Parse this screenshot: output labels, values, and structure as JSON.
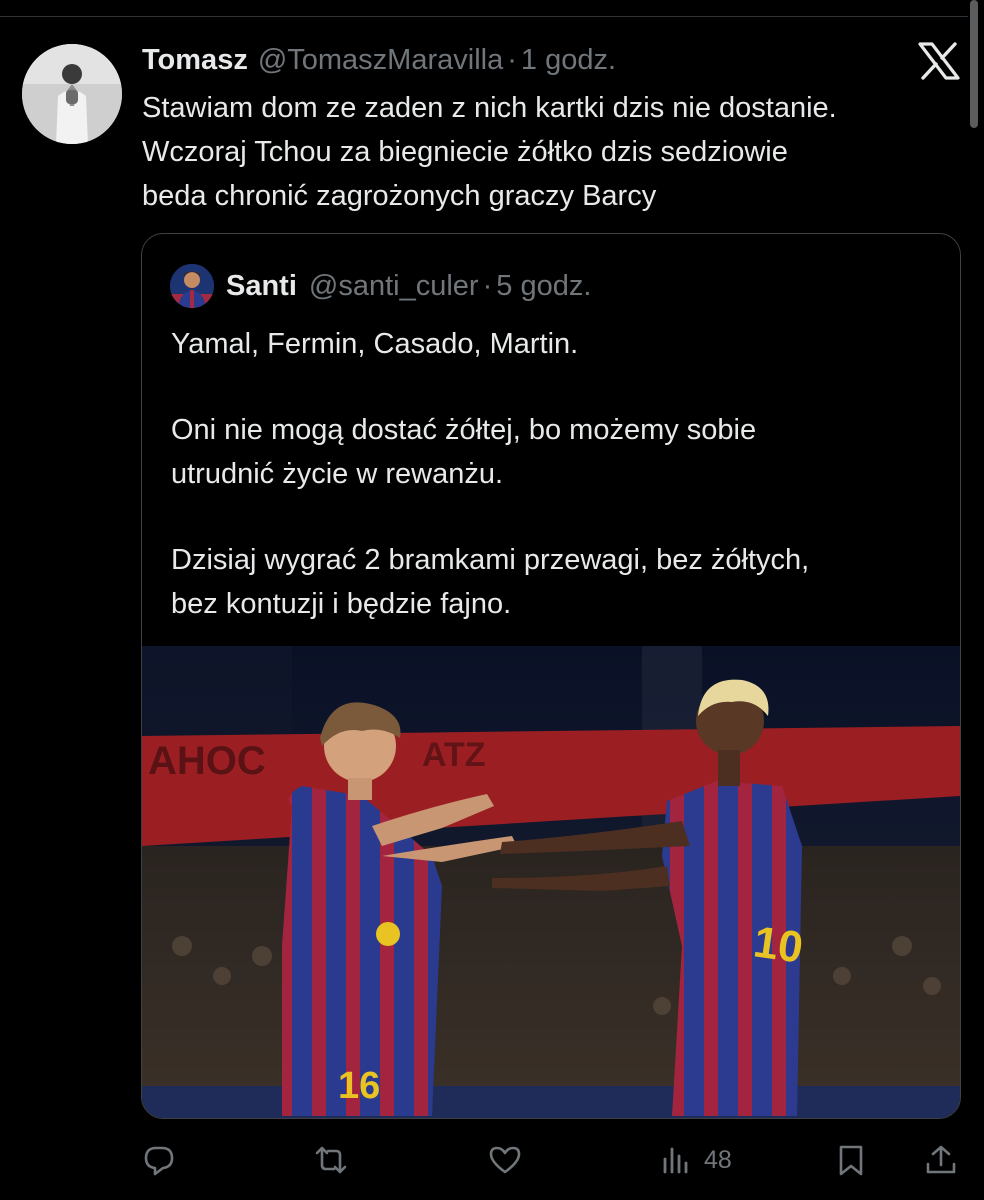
{
  "post": {
    "author_name": "Tomasz",
    "author_handle": "@TomaszMaravilla",
    "separator": "·",
    "time": "1 godz.",
    "text_lines": [
      "Stawiam dom ze zaden z nich kartki dzis nie dostanie.",
      "Wczoraj Tchou za biegniecie żółtko dzis sedziowie",
      "beda chronić zagrożonych graczy Barcy"
    ]
  },
  "quote": {
    "author_name": "Santi",
    "author_handle": "@santi_culer",
    "separator": "·",
    "time": "5 godz.",
    "text_lines": [
      "Yamal, Fermin, Casado, Martin.",
      "",
      "Oni nie mogą dostać żółtej, bo możemy sobie",
      "utrudnić życie w rewanżu.",
      "",
      "Dzisiaj wygrać 2 bramkami przewagi, bez żółtych,",
      "bez kontuzji i będzie fajno."
    ],
    "photo": {
      "left_player_number": "16",
      "right_player_number": "10"
    }
  },
  "actions": {
    "views_count": "48"
  },
  "icons": {
    "brand": "x-logo-icon",
    "reply": "reply-icon",
    "retweet": "retweet-icon",
    "like": "heart-icon",
    "views": "views-chart-icon",
    "bookmark": "bookmark-icon",
    "share": "share-icon"
  },
  "colors": {
    "background": "#000000",
    "primary_text": "#e7e9ea",
    "secondary_text": "#71767b",
    "border": "#3e4144",
    "kit_blue": "#2a3a8f",
    "kit_red": "#a3243f"
  }
}
